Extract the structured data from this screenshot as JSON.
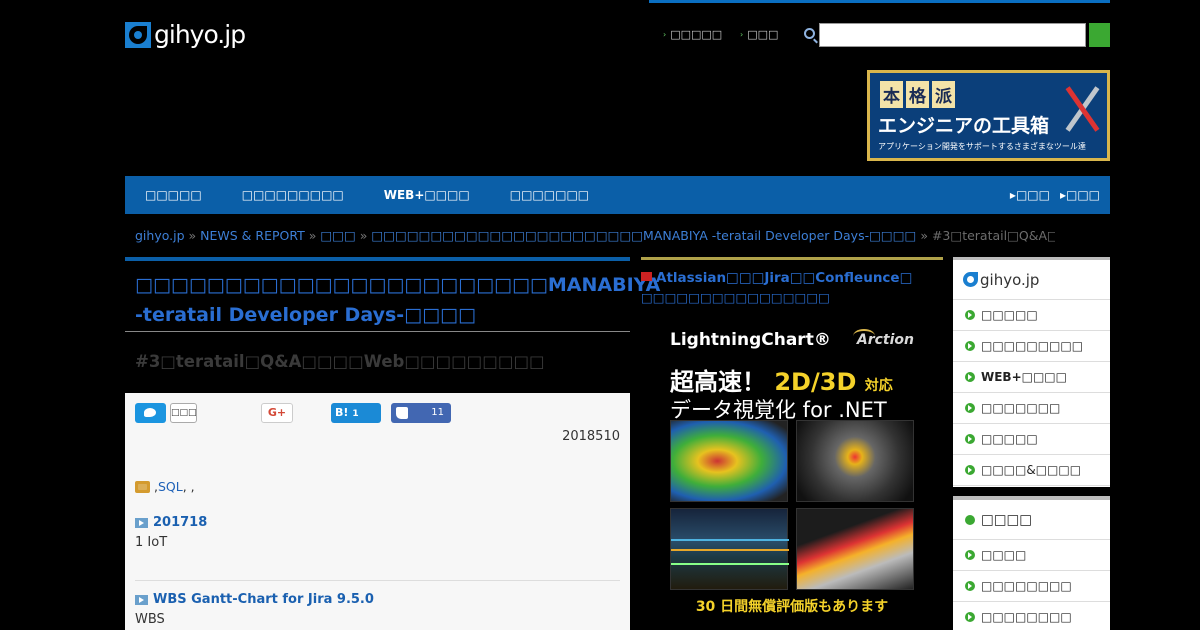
{
  "header": {
    "logo_text": "gihyo.jp",
    "util_links": [
      "□□□□□",
      "□□□"
    ],
    "search": {
      "placeholder": ""
    },
    "banner": {
      "title_chars": [
        "本",
        "格",
        "派"
      ],
      "title_main": "エンジニアの工具箱",
      "subtitle": "アプリケーション開発をサポートするさまざまなツール達"
    }
  },
  "nav": {
    "items": [
      "□□□□□",
      "□□□□□□□□□",
      "WEB+□□□□",
      "□□□□□□□"
    ],
    "right": [
      "□□□",
      "□□□"
    ]
  },
  "breadcrumb": {
    "items": [
      "gihyo.jp",
      "NEWS & REPORT",
      "□□□",
      "□□□□□□□□□□□□□□□□□□□□□□□MANABIYA -teratail Developer Days-□□□□"
    ],
    "current": "#3□teratail□Q&A□□□□Web□□□□□□□□□"
  },
  "article": {
    "series_title": "□□□□□□□□□□□□□□□□□□□□□□□MANABIYA -teratail Developer Days-□□□□",
    "title": "#3□teratail□Q&A□□□□Web□□□□□□□□□",
    "share": {
      "tweet_count": "□□□",
      "gplus_label": "G+",
      "hatena_label": "B!",
      "hatena_count": "1",
      "fb_count": "11"
    },
    "date": "2018510",
    "tags_prefix": ", ",
    "tag_link": "SQL",
    "tags_suffix": ", ,",
    "related": [
      {
        "title": "201718",
        "body": "1 IoT"
      },
      {
        "title": "WBS Gantt-Chart for Jira 9.5.0",
        "body": "WBS"
      }
    ]
  },
  "middle": {
    "news_title": "Atlassian□□□Jira□□Confleunce□",
    "news_sub": "□□□□□□□□□□□□□□□□",
    "ad": {
      "brand": "LightningChart®",
      "maker": "Arction",
      "headline_yellow": "超高速！",
      "headline_main": "2D/3D",
      "headline_small": "対応",
      "subline": "データ視覚化 for .NET",
      "cta": "30 日間無償評価版もあります"
    }
  },
  "sidebar": {
    "logo_text": "gihyo.jp",
    "items": [
      "□□□□□",
      "□□□□□□□□□",
      "WEB+□□□□",
      "□□□□□□□",
      "□□□□□",
      "□□□□&□□□□"
    ],
    "section2_title": "□□□□",
    "items2": [
      "□□□□",
      "□□□□□□□□",
      "□□□□□□□□"
    ]
  },
  "colors": {
    "nav_blue": "#0b5fa8",
    "link_blue": "#2a6ed2",
    "accent_green": "#3ba832"
  }
}
